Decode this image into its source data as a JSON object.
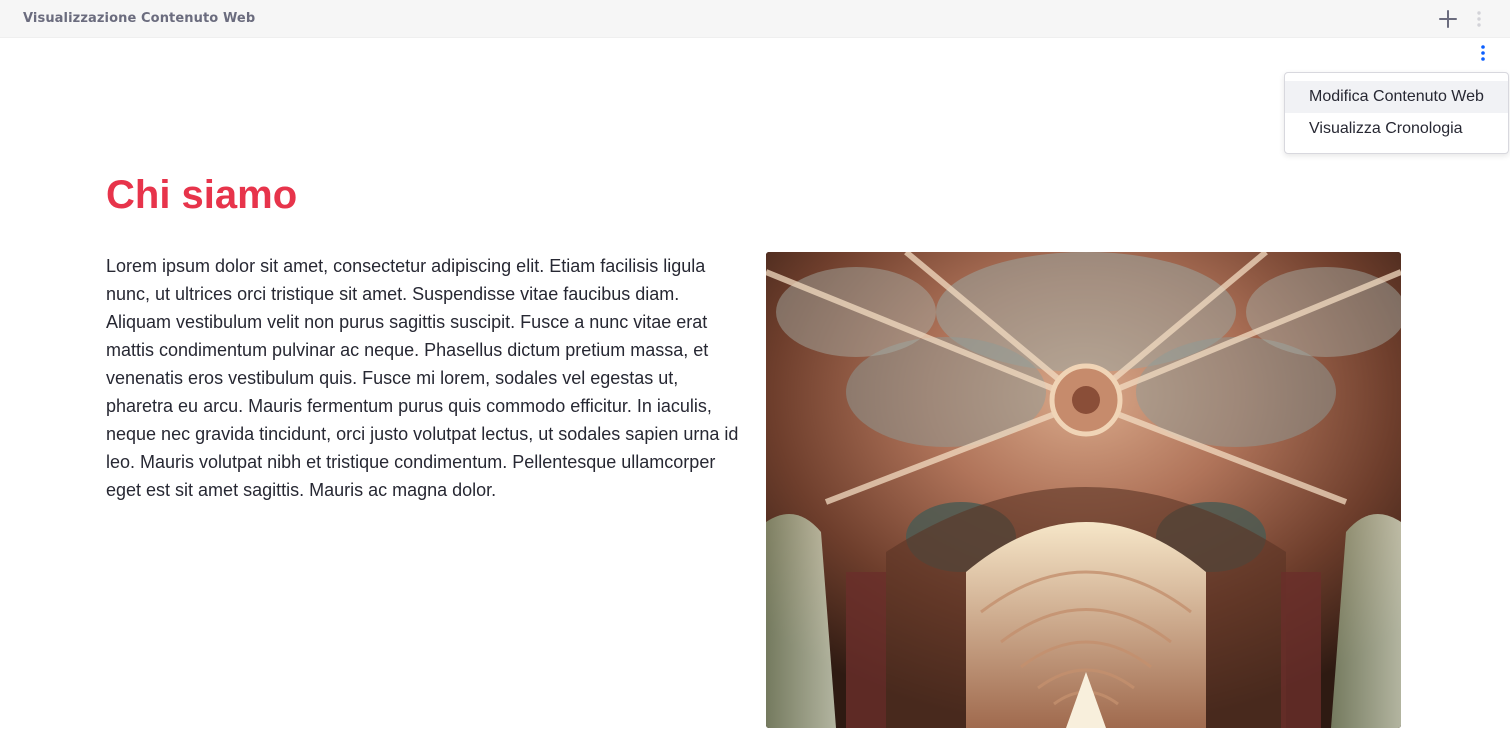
{
  "header": {
    "title": "Visualizzazione Contenuto Web",
    "add_icon": "plus-icon",
    "options_icon": "kebab-vertical-icon"
  },
  "actions_menu": {
    "trigger_icon": "kebab-vertical-icon",
    "items": [
      {
        "label": "Modifica Contenuto Web"
      },
      {
        "label": "Visualizza Cronologia"
      }
    ]
  },
  "content": {
    "title": "Chi siamo",
    "body": "Lorem ipsum dolor sit amet, consectetur adipiscing elit. Etiam facilisis ligula nunc, ut ultrices orci tristique sit amet. Suspendisse vitae faucibus diam. Aliquam vestibulum velit non purus sagittis suscipit. Fusce a nunc vitae erat mattis condimentum pulvinar ac neque. Phasellus dictum pretium massa, et venenatis eros vestibulum quis. Fusce mi lorem, sodales vel egestas ut, pharetra eu arcu. Mauris fermentum purus quis commodo efficitur. In iaculis, neque nec gravida tincidunt, orci justo volutpat lectus, ut sodales sapien urna id leo. Mauris volutpat nibh et tristique condimentum. Pellentesque ullamcorper eget est sit amet sagittis. Mauris ac magna dolor."
  },
  "colors": {
    "title_accent": "#e7344b",
    "kebab_blue": "#0b5fff",
    "header_bg": "#f6f6f6"
  }
}
